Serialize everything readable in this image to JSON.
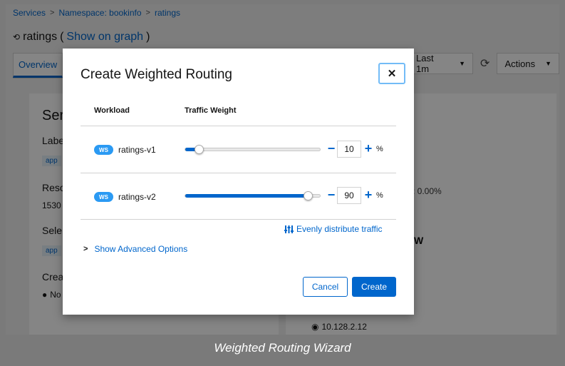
{
  "breadcrumb": [
    "Services",
    "Namespace: bookinfo",
    "ratings"
  ],
  "page": {
    "title": "ratings",
    "graph_link": "Show on graph",
    "tab_overview": "Overview",
    "time_range": "Last 1m",
    "actions": "Actions"
  },
  "background": {
    "left_heading": "Ser",
    "labels": "Labe",
    "label_chip": "app",
    "resource": "Reso",
    "resource_value": "1530",
    "selector": "Sele",
    "selector_chip": "app",
    "created": "Crea",
    "created_value": "No",
    "error_rate": ": 0.00%",
    "right_heading": "W",
    "ip": "10.128.2.12"
  },
  "modal": {
    "title": "Create Weighted Routing",
    "close_label": "✕",
    "col_workload": "Workload",
    "col_weight": "Traffic Weight",
    "rows": [
      {
        "badge": "WS",
        "name": "ratings-v1",
        "weight": 10,
        "minus": "−",
        "plus": "+",
        "pct": "%"
      },
      {
        "badge": "WS",
        "name": "ratings-v2",
        "weight": 90,
        "minus": "−",
        "plus": "+",
        "pct": "%"
      }
    ],
    "evenly": "Evenly distribute traffic",
    "advanced": "Show Advanced Options",
    "cancel": "Cancel",
    "create": "Create"
  },
  "caption": "Weighted Routing Wizard",
  "colors": {
    "accent": "#0066cc",
    "badge": "#2b9af3"
  }
}
